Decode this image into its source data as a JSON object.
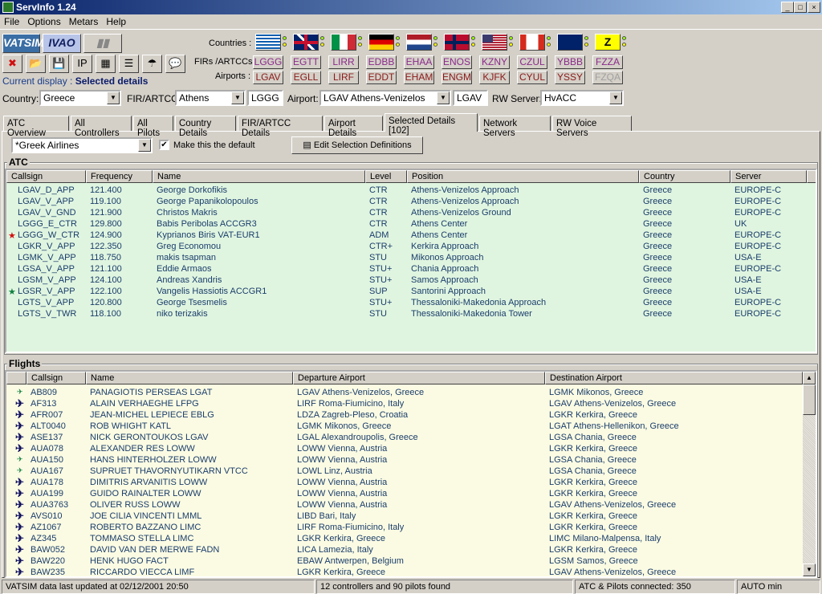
{
  "window": {
    "title": "ServInfo 1.24",
    "minimize": "_",
    "maximize": "□",
    "close": "×"
  },
  "menu": [
    "File",
    "Options",
    "Metars",
    "Help"
  ],
  "networks": [
    "VATSIM",
    "IVAO"
  ],
  "toolbar_icons": [
    "close-icon",
    "folder-open-icon",
    "save-icon",
    "ip-icon",
    "grid-icon",
    "list-icon",
    "weather-icon",
    "message-icon"
  ],
  "current_display": {
    "label": "Current display :",
    "value": "Selected details"
  },
  "labels": {
    "countries": "Countries :",
    "firs": "FIRs /ARTCCs:",
    "airports": "Airports :"
  },
  "flags": [
    "greece",
    "uk",
    "italy",
    "germany",
    "netherlands",
    "norway",
    "usa",
    "canada",
    "australia",
    "z"
  ],
  "flag_z_text": "Z",
  "firs": [
    "LGGG",
    "EGTT",
    "LIRR",
    "EDBB",
    "EHAA",
    "ENOS",
    "KZNY",
    "CZUL",
    "YBBB",
    "FZZA"
  ],
  "airports": [
    "LGAV",
    "EGLL",
    "LIRF",
    "EDDT",
    "EHAM",
    "ENGM",
    "KJFK",
    "CYUL",
    "YSSY",
    "FZQA"
  ],
  "colors": {
    "fir_text": "#8b2a8b",
    "airport_text": "#8b1a1a",
    "atc_bg": "#e0f5e0",
    "flights_bg": "#fbfbe3",
    "row_text": "#1a3d6b"
  },
  "filters": {
    "country_label": "Country:",
    "country": "Greece",
    "fir_label": "FIR/ARTCC:",
    "fir": "Athens",
    "fir_code": "LGGG",
    "airport_label": "Airport:",
    "airport": "LGAV Athens-Venizelos",
    "airport_code": "LGAV",
    "rw_label": "RW Server:",
    "rw_server": "HvACC"
  },
  "tabs": [
    "ATC Overview",
    "All Controllers",
    "All Pilots",
    "Country Details",
    "FIR/ARTCC Details",
    "Airport Details",
    "Selected Details [102]",
    "Network Servers",
    "RW Voice Servers"
  ],
  "active_tab": "Selected Details [102]",
  "selection": {
    "value": "*Greek Airlines",
    "default_label": "Make this the default",
    "default_checked": true,
    "edit_button": "Edit Selection Definitions"
  },
  "atc": {
    "title": "ATC",
    "columns": [
      "Callsign",
      "Frequency",
      "Name",
      "Level",
      "Position",
      "Country",
      "Server"
    ],
    "rows": [
      [
        "",
        "LGAV_D_APP",
        "121.400",
        "George Dorkofikis",
        "CTR",
        "Athens-Venizelos Approach",
        "Greece",
        "EUROPE-C"
      ],
      [
        "",
        "LGAV_V_APP",
        "119.100",
        "George Papanikolopoulos",
        "CTR",
        "Athens-Venizelos Approach",
        "Greece",
        "EUROPE-C"
      ],
      [
        "",
        "LGAV_V_GND",
        "121.900",
        "Christos Makris",
        "CTR",
        "Athens-Venizelos Ground",
        "Greece",
        "EUROPE-C"
      ],
      [
        "",
        "LGGG_E_CTR",
        "129.800",
        "Babis Peribolas ACCGR3",
        "CTR",
        "Athens Center",
        "Greece",
        "UK"
      ],
      [
        "red-star",
        "LGGG_W_CTR",
        "124.900",
        "Kyprianos Biris VAT-EUR1",
        "ADM",
        "Athens Center",
        "Greece",
        "EUROPE-C"
      ],
      [
        "",
        "LGKR_V_APP",
        "122.350",
        "Greg Economou",
        "CTR+",
        "Kerkira Approach",
        "Greece",
        "EUROPE-C"
      ],
      [
        "",
        "LGMK_V_APP",
        "118.750",
        "makis tsapman",
        "STU",
        "Mikonos Approach",
        "Greece",
        "USA-E"
      ],
      [
        "",
        "LGSA_V_APP",
        "121.100",
        "Eddie Armaos",
        "STU+",
        "Chania Approach",
        "Greece",
        "EUROPE-C"
      ],
      [
        "",
        "LGSM_V_APP",
        "124.100",
        "Andreas Xandris",
        "STU+",
        "Samos Approach",
        "Greece",
        "USA-E"
      ],
      [
        "green-star",
        "LGSR_V_APP",
        "122.100",
        "Vangelis Hassiotis ACCGR1",
        "SUP",
        "Santorini Approach",
        "Greece",
        "USA-E"
      ],
      [
        "",
        "LGTS_V_APP",
        "120.800",
        "George Tsesmelis",
        "STU+",
        "Thessaloniki-Makedonia Approach",
        "Greece",
        "EUROPE-C"
      ],
      [
        "",
        "LGTS_V_TWR",
        "118.100",
        "niko terizakis",
        "STU",
        "Thessaloniki-Makedonia Tower",
        "Greece",
        "EUROPE-C"
      ]
    ]
  },
  "flights": {
    "title": "Flights",
    "columns": [
      "",
      "Callsign",
      "Name",
      "Departure Airport",
      "Destination Airport"
    ],
    "rows": [
      [
        "ground",
        "AB809",
        "PANAGIOTIS PERSEAS LGAT",
        "LGAV Athens-Venizelos, Greece",
        "LGMK Mikonos, Greece"
      ],
      [
        "airborne",
        "AF313",
        "ALAIN VERHAEGHE LFPG",
        "LIRF Roma-Fiumicino, Italy",
        "LGAV Athens-Venizelos, Greece"
      ],
      [
        "airborne",
        "AFR007",
        "JEAN-MICHEL LEPIECE EBLG",
        "LDZA Zagreb-Pleso, Croatia",
        "LGKR Kerkira, Greece"
      ],
      [
        "airborne",
        "ALT0040",
        "ROB WHIGHT KATL",
        "LGMK Mikonos, Greece",
        "LGAT Athens-Hellenikon, Greece"
      ],
      [
        "airborne",
        "ASE137",
        "NICK GERONTOUKOS LGAV",
        "LGAL Alexandroupolis, Greece",
        "LGSA Chania, Greece"
      ],
      [
        "airborne",
        "AUA078",
        "ALEXANDER RES LOWW",
        "LOWW Vienna, Austria",
        "LGKR Kerkira, Greece"
      ],
      [
        "ground",
        "AUA150",
        "HANS HINTERHOLZER LOWW",
        "LOWW Vienna, Austria",
        "LGSA Chania, Greece"
      ],
      [
        "ground",
        "AUA167",
        "SUPRUET THAVORNYUTIKARN VTCC",
        "LOWL Linz, Austria",
        "LGSA Chania, Greece"
      ],
      [
        "airborne",
        "AUA178",
        "DIMITRIS ARVANITIS LOWW",
        "LOWW Vienna, Austria",
        "LGKR Kerkira, Greece"
      ],
      [
        "airborne",
        "AUA199",
        "GUIDO RAINALTER LOWW",
        "LOWW Vienna, Austria",
        "LGKR Kerkira, Greece"
      ],
      [
        "airborne",
        "AUA3763",
        "OLIVER RUSS LOWW",
        "LOWW Vienna, Austria",
        "LGAV Athens-Venizelos, Greece"
      ],
      [
        "airborne",
        "AVS010",
        "JOE CILIA VINCENTI LMML",
        "LIBD Bari, Italy",
        "LGKR Kerkira, Greece"
      ],
      [
        "airborne",
        "AZ1067",
        "ROBERTO BAZZANO LIMC",
        "LIRF Roma-Fiumicino, Italy",
        "LGKR Kerkira, Greece"
      ],
      [
        "airborne",
        "AZ345",
        "TOMMASO STELLA LIMC",
        "LGKR Kerkira, Greece",
        "LIMC Milano-Malpensa, Italy"
      ],
      [
        "airborne",
        "BAW052",
        "DAVID VAN DER MERWE FADN",
        "LICA Lamezia, Italy",
        "LGKR Kerkira, Greece"
      ],
      [
        "airborne",
        "BAW220",
        "HENK HUGO FACT",
        "EBAW Antwerpen, Belgium",
        "LGSM Samos, Greece"
      ],
      [
        "airborne",
        "BAW235",
        "RICCARDO VIECCA LIMF",
        "LGKR Kerkira, Greece",
        "LGAV Athens-Venizelos, Greece"
      ]
    ]
  },
  "statusbar": [
    "VATSIM data last updated at 02/12/2001 20:50",
    "12 controllers and 90 pilots found",
    "ATC & Pilots connected: 350",
    "AUTO min"
  ]
}
